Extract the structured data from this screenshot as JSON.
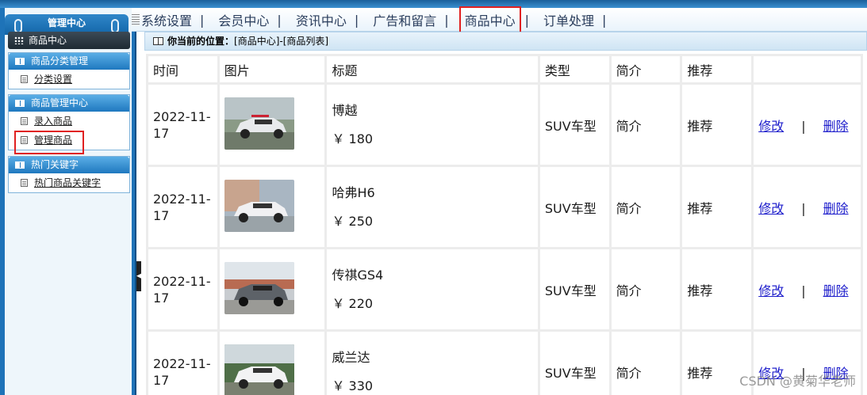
{
  "sidebar": {
    "header": "管理中心",
    "current": "商品中心",
    "sections": [
      {
        "title": "商品分类管理",
        "items": [
          "分类设置"
        ]
      },
      {
        "title": "商品管理中心",
        "items": [
          "录入商品",
          "管理商品"
        ]
      },
      {
        "title": "热门关键字",
        "items": [
          "热门商品关键字"
        ]
      }
    ]
  },
  "nav": {
    "items": [
      "系统设置",
      "会员中心",
      "资讯中心",
      "广告和留言",
      "商品中心",
      "订单处理"
    ],
    "separator": "|",
    "active": "商品中心"
  },
  "breadcrumb": {
    "label": "你当前的位置：",
    "path": "[商品中心]-[商品列表]"
  },
  "table": {
    "headers": [
      "时间",
      "图片",
      "标题",
      "类型",
      "简介",
      "推荐",
      ""
    ],
    "rows": [
      {
        "date": "2022-11-17",
        "title": "博越",
        "price": "￥ 180",
        "type": "SUV车型",
        "intro": "简介",
        "recommend": "推荐",
        "edit": "修改",
        "sep": "|",
        "del": "删除"
      },
      {
        "date": "2022-11-17",
        "title": "哈弗H6",
        "price": "￥ 250",
        "type": "SUV车型",
        "intro": "简介",
        "recommend": "推荐",
        "edit": "修改",
        "sep": "|",
        "del": "删除"
      },
      {
        "date": "2022-11-17",
        "title": "传祺GS4",
        "price": "￥ 220",
        "type": "SUV车型",
        "intro": "简介",
        "recommend": "推荐",
        "edit": "修改",
        "sep": "|",
        "del": "删除"
      },
      {
        "date": "2022-11-17",
        "title": "威兰达",
        "price": "￥ 330",
        "type": "SUV车型",
        "intro": "简介",
        "recommend": "推荐",
        "edit": "修改",
        "sep": "|",
        "del": "删除"
      }
    ]
  },
  "watermark": "CSDN @黄菊华老师",
  "colors": {
    "highlight": "#e02020",
    "link": "#2020cc",
    "sidebar": "#1e73b8"
  }
}
